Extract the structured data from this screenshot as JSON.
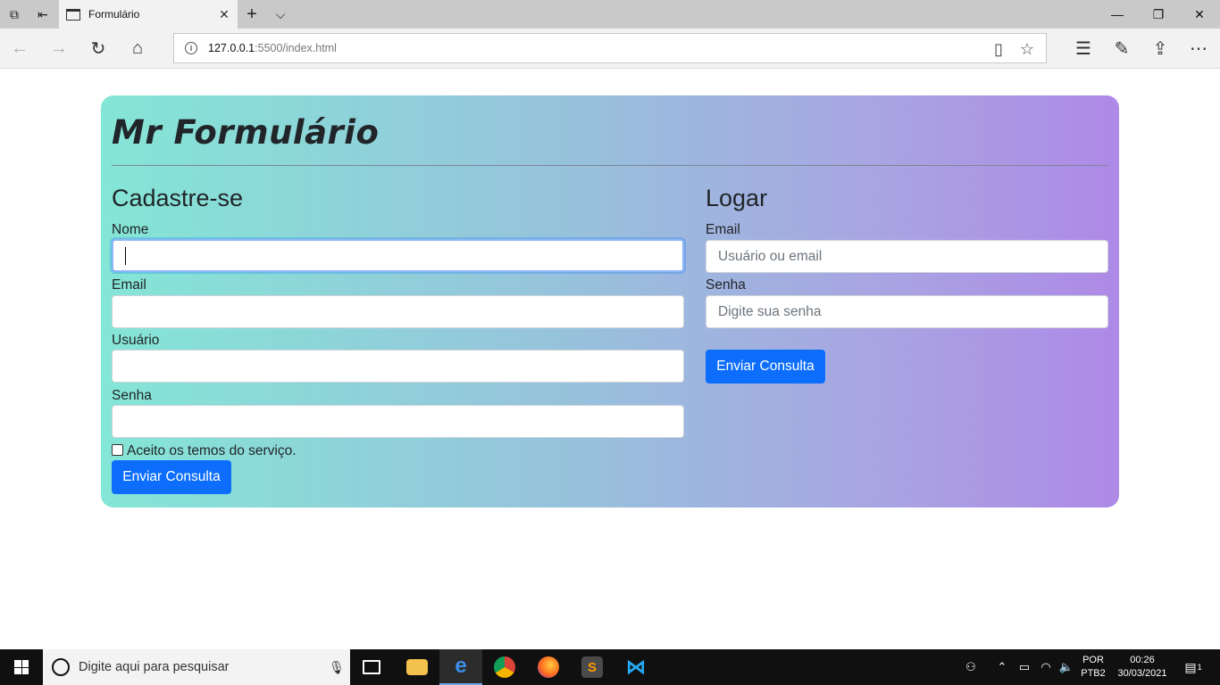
{
  "browser": {
    "tab_title": "Formulário",
    "url_host": "127.0.0.1",
    "url_rest": ":5500/index.html"
  },
  "page": {
    "heading": "Mr Formulário",
    "register": {
      "title": "Cadastre-se",
      "name_label": "Nome",
      "email_label": "Email",
      "user_label": "Usuário",
      "password_label": "Senha",
      "terms_label": "Aceito os temos do serviço.",
      "submit_label": "Enviar Consulta"
    },
    "login": {
      "title": "Logar",
      "email_label": "Email",
      "email_placeholder": "Usuário ou email",
      "password_label": "Senha",
      "password_placeholder": "Digite sua senha",
      "submit_label": "Enviar Consulta"
    }
  },
  "taskbar": {
    "search_placeholder": "Digite aqui para pesquisar",
    "lang_top": "POR",
    "lang_bottom": "PTB2",
    "time": "00:26",
    "date": "30/03/2021",
    "notification_count": "1"
  },
  "colors": {
    "primary_button": "#0d6efd",
    "gradient_start": "#84e6d6",
    "gradient_end": "#ae89e7"
  }
}
